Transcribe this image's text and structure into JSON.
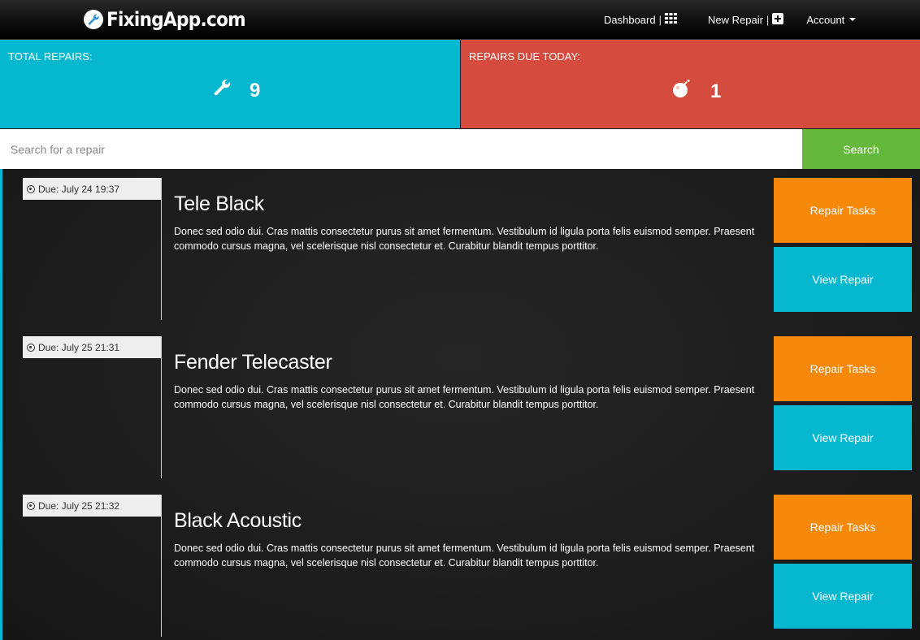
{
  "navbar": {
    "brand": "FixingApp.com",
    "brand_icon": "wrench-icon",
    "links": {
      "dashboard": "Dashboard",
      "new_repair": "New Repair",
      "account": "Account"
    },
    "separator": "|"
  },
  "stats": {
    "total": {
      "label": "TOTAL REPAIRS:",
      "value": "9",
      "icon": "wrench-icon"
    },
    "due_today": {
      "label": "REPAIRS DUE TODAY:",
      "value": "1",
      "icon": "bomb-icon"
    }
  },
  "search": {
    "placeholder": "Search for a repair",
    "value": "",
    "button_label": "Search"
  },
  "repairs": [
    {
      "due": "Due: July 24 19:37",
      "title": "Tele Black",
      "description": "Donec sed odio dui. Cras mattis consectetur purus sit amet fermentum. Vestibulum id ligula porta felis euismod semper. Praesent commodo cursus magna, vel scelerisque nisl consectetur et. Curabitur blandit tempus porttitor.",
      "tasks_label": "Repair Tasks",
      "view_label": "View Repair"
    },
    {
      "due": "Due: July 25 21:31",
      "title": "Fender Telecaster",
      "description": "Donec sed odio dui. Cras mattis consectetur purus sit amet fermentum. Vestibulum id ligula porta felis euismod semper. Praesent commodo cursus magna, vel scelerisque nisl consectetur et. Curabitur blandit tempus porttitor.",
      "tasks_label": "Repair Tasks",
      "view_label": "View Repair"
    },
    {
      "due": "Due: July 25 21:32",
      "title": "Black Acoustic",
      "description": "Donec sed odio dui. Cras mattis consectetur purus sit amet fermentum. Vestibulum id ligula porta felis euismod semper. Praesent commodo cursus magna, vel scelerisque nisl consectetur et. Curabitur blandit tempus porttitor.",
      "tasks_label": "Repair Tasks",
      "view_label": "View Repair"
    }
  ],
  "colors": {
    "accent_cyan": "#06b7d0",
    "danger_red": "#d54b3d",
    "search_green": "#64b83b",
    "tasks_orange": "#f7890a"
  }
}
